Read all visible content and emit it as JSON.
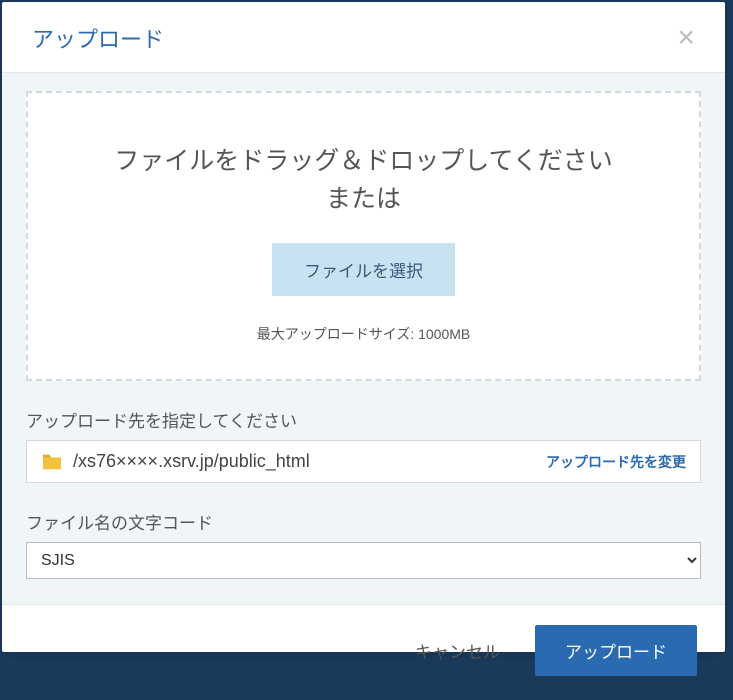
{
  "modal": {
    "title": "アップロード"
  },
  "dropzone": {
    "line1": "ファイルをドラッグ＆ドロップしてください",
    "line2": "または",
    "select_button": "ファイルを選択",
    "max_size": "最大アップロードサイズ: 1000MB"
  },
  "destination": {
    "label": "アップロード先を指定してください",
    "path": "/xs76××××.xsrv.jp/public_html",
    "change_link": "アップロード先を変更"
  },
  "encoding": {
    "label": "ファイル名の文字コード",
    "selected": "SJIS"
  },
  "footer": {
    "cancel": "キャンセル",
    "submit": "アップロード"
  }
}
